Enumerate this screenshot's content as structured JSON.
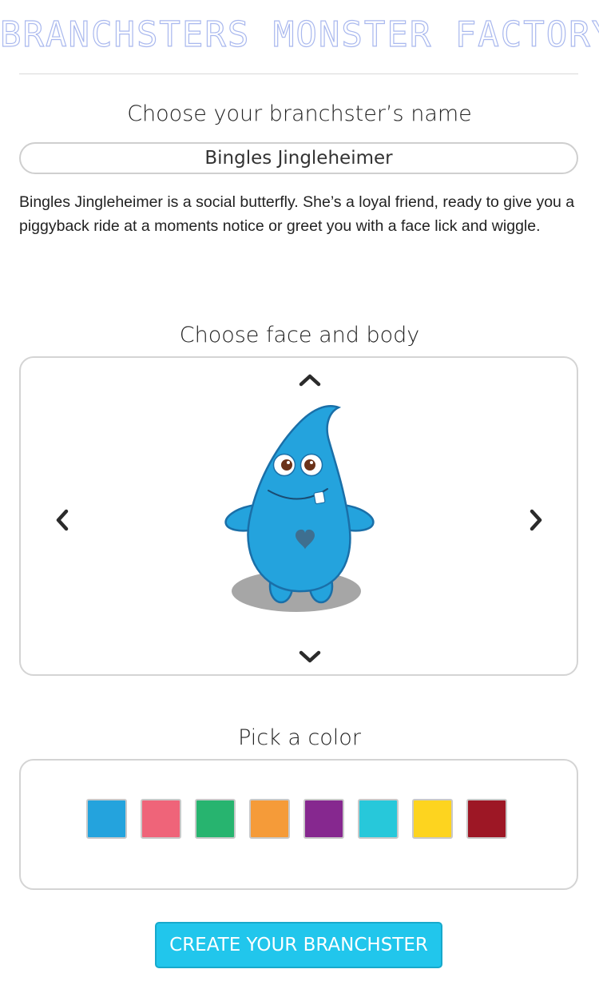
{
  "header": {
    "logo_text": "BRANCHSTERS MONSTER FACTORY"
  },
  "name_section": {
    "title": "Choose your branchster’s name",
    "input_value": "Bingles Jingleheimer",
    "description": "Bingles Jingleheimer is a social butterfly. She’s a loyal friend, ready to give you a piggyback ride at a moments notice or greet you with a face lick and wiggle."
  },
  "face_section": {
    "title": "Choose face and body",
    "icons": {
      "up": "chevron-up-icon",
      "down": "chevron-down-icon",
      "left": "chevron-left-icon",
      "right": "chevron-right-icon"
    },
    "monster_color": "#24a3dd"
  },
  "color_section": {
    "title": "Pick a color",
    "swatches": [
      "#24a3dd",
      "#ef6479",
      "#27b46f",
      "#f59b39",
      "#86288f",
      "#27c8da",
      "#fdd41f",
      "#9d1725"
    ]
  },
  "cta": {
    "label": "CREATE YOUR BRANCHSTER"
  }
}
